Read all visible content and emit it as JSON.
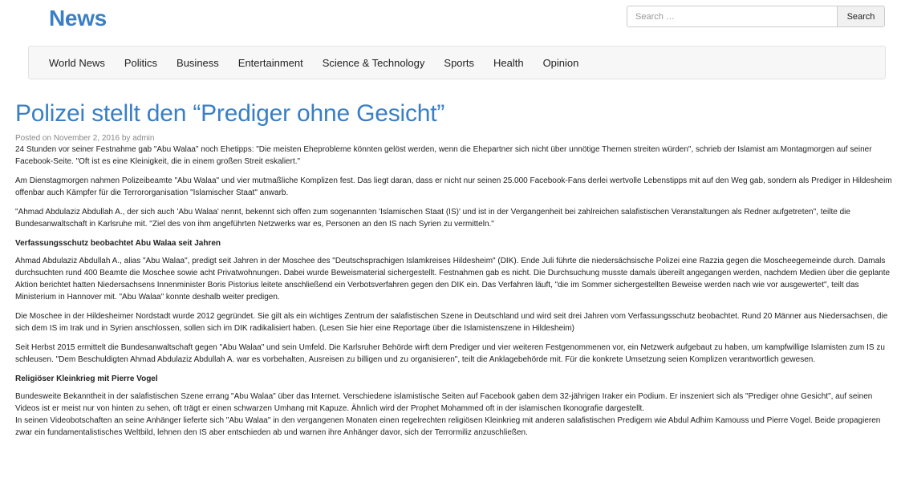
{
  "site": {
    "title": "News"
  },
  "search": {
    "placeholder": "Search …",
    "button_label": "Search"
  },
  "nav": {
    "items": [
      "World News",
      "Politics",
      "Business",
      "Entertainment",
      "Science & Technology",
      "Sports",
      "Health",
      "Opinion"
    ]
  },
  "article": {
    "title": "Polizei stellt den “Prediger ohne Gesicht”",
    "meta": "Posted on November 2, 2016 by admin",
    "p1": "24 Stunden vor seiner Festnahme gab \"Abu Walaa\" noch Ehetipps: \"Die meisten Eheprobleme könnten gelöst werden, wenn die Ehepartner sich nicht über unnötige Themen streiten würden\", schrieb der Islamist am Montagmorgen auf seiner Facebook-Seite. \"Oft ist es eine Kleinigkeit, die in einem großen Streit eskaliert.\"",
    "p2": "Am Dienstagmorgen nahmen Polizeibeamte \"Abu Walaa\" und vier mutmaßliche Komplizen fest. Das liegt daran, dass er nicht nur seinen 25.000 Facebook-Fans derlei wertvolle Lebenstipps mit auf den Weg gab, sondern als Prediger in Hildesheim offenbar auch Kämpfer für die Terrororganisation \"Islamischer Staat\" anwarb.",
    "p3": "\"Ahmad Abdulaziz Abdullah A., der sich auch 'Abu Walaa' nennt, bekennt sich offen zum sogenannten 'Islamischen Staat (IS)' und ist in der Vergangenheit bei zahlreichen salafistischen Veranstaltungen als Redner aufgetreten\", teilte die Bundesanwaltschaft in Karlsruhe mit. \"Ziel des von ihm angeführten Netzwerks war es, Personen an den IS nach Syrien zu vermitteln.\"",
    "h1": "Verfassungsschutz beobachtet Abu Walaa seit Jahren",
    "p4": "Ahmad Abdulaziz Abdullah A., alias \"Abu Walaa\", predigt seit Jahren in der Moschee des \"Deutschsprachigen Islamkreises Hildesheim\" (DIK). Ende Juli führte die niedersächsische Polizei eine Razzia gegen die Moscheegemeinde durch. Damals durchsuchten rund 400 Beamte die Moschee sowie acht Privatwohnungen. Dabei wurde Beweismaterial sichergestellt. Festnahmen gab es nicht. Die Durchsuchung musste damals übereilt angegangen werden, nachdem Medien über die geplante Aktion berichtet hatten Niedersachsens Innenminister Boris Pistorius leitete anschließend ein Verbotsverfahren gegen den DIK ein. Das Verfahren läuft, \"die im Sommer sichergestellten Beweise werden nach wie vor ausgewertet\", teilt das Ministerium in Hannover mit. \"Abu Walaa\" konnte deshalb weiter predigen.",
    "p5": "Die Moschee in der Hildesheimer Nordstadt wurde 2012 gegründet. Sie gilt als ein wichtiges Zentrum der salafistischen Szene in Deutschland und wird seit drei Jahren vom Verfassungsschutz beobachtet. Rund 20 Männer aus Niedersachsen, die sich dem IS im Irak und in Syrien anschlossen, sollen sich im DIK radikalisiert haben. (Lesen Sie hier eine Reportage über die Islamistenszene in Hildesheim)",
    "p6": "Seit Herbst 2015 ermittelt die Bundesanwaltschaft gegen \"Abu Walaa\" und sein Umfeld. Die Karlsruher Behörde wirft dem Prediger und vier weiteren Festgenommenen vor, ein Netzwerk aufgebaut zu haben, um kampfwillige Islamisten zum IS zu schleusen. \"Dem Beschuldigten Ahmad Abdulaziz Abdullah A. war es vorbehalten, Ausreisen zu billigen und zu organisieren\", teilt die Anklagebehörde mit. Für die konkrete Umsetzung seien Komplizen verantwortlich gewesen.",
    "h2": "Religiöser Kleinkrieg mit Pierre Vogel",
    "p7": "Bundesweite Bekanntheit in der salafistischen Szene errang \"Abu Walaa\" über das Internet. Verschiedene islamistische Seiten auf Facebook gaben dem 32-jährigen Iraker ein Podium. Er inszeniert sich als \"Prediger ohne Gesicht\", auf seinen Videos ist er meist nur von hinten zu sehen, oft trägt er einen schwarzen Umhang mit Kapuze. Ähnlich wird der Prophet Mohammed oft in der islamischen Ikonografie dargestellt.",
    "p8": "In seinen Videobotschaften an seine Anhänger lieferte sich \"Abu Walaa\" in den vergangenen Monaten einen regelrechten religiösen Kleinkrieg mit anderen salafistischen Predigern wie Abdul Adhim Kamouss und Pierre Vogel. Beide propagieren zwar ein fundamentalistisches Weltbild, lehnen den IS aber entschieden ab und warnen ihre Anhänger davor, sich der Terrormiliz anzuschließen."
  }
}
